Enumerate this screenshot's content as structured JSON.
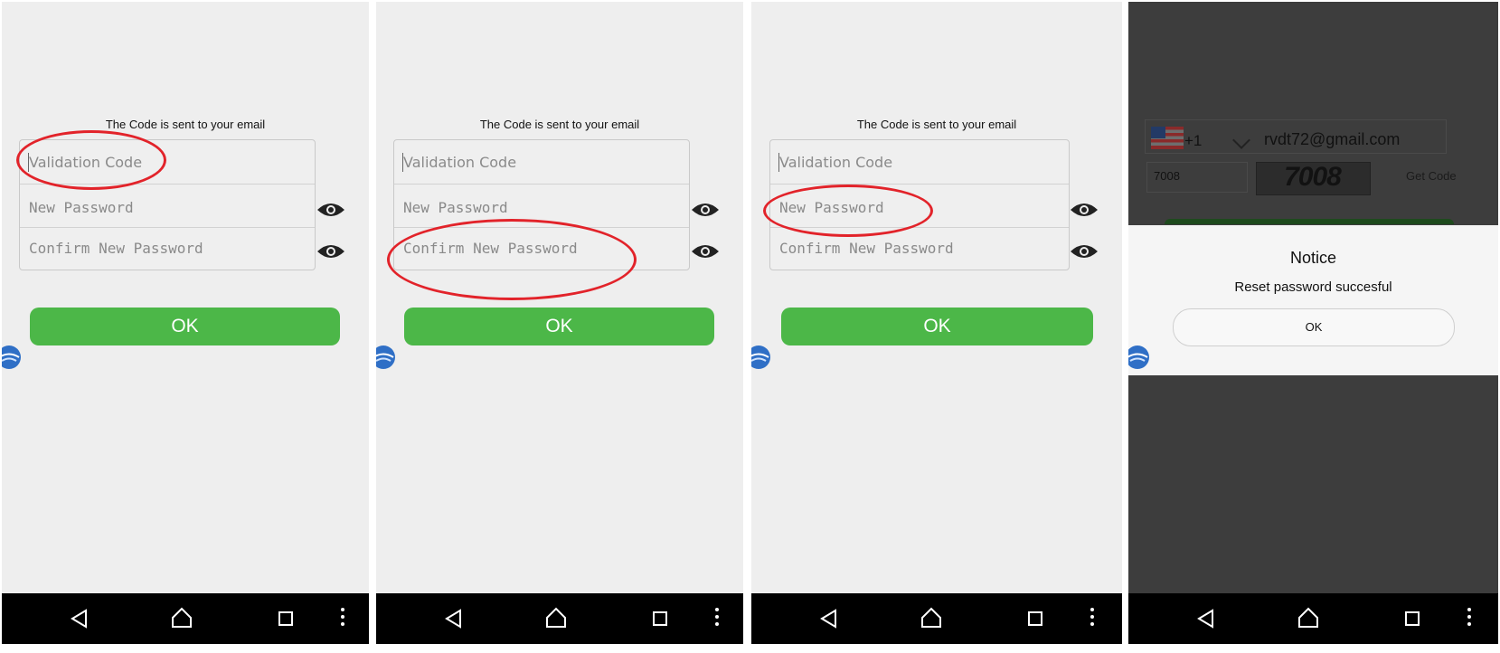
{
  "form": {
    "hint": "The Code is sent to your email",
    "validation_placeholder": "Validation Code",
    "new_password_placeholder": "New Password",
    "confirm_password_placeholder": "Confirm New Password",
    "ok_label": "OK"
  },
  "panel4": {
    "country_code": "+1",
    "email": "rvdt72@gmail.com",
    "code_value": "7008",
    "captcha_text": "7008",
    "get_code_label": "Get Code",
    "dialog": {
      "title": "Notice",
      "message": "Reset password succesful",
      "ok_label": "OK"
    }
  },
  "colors": {
    "ok_green": "#4cb748",
    "highlight_red": "#e2232a",
    "panel_bg": "#eeeeee",
    "overlay_bg": "#3d3d3d"
  },
  "icons": [
    "eye-icon",
    "back-icon",
    "home-icon",
    "recents-icon",
    "overflow-menu-icon",
    "floating-bubble-icon",
    "us-flag-icon",
    "chevron-down-icon"
  ]
}
